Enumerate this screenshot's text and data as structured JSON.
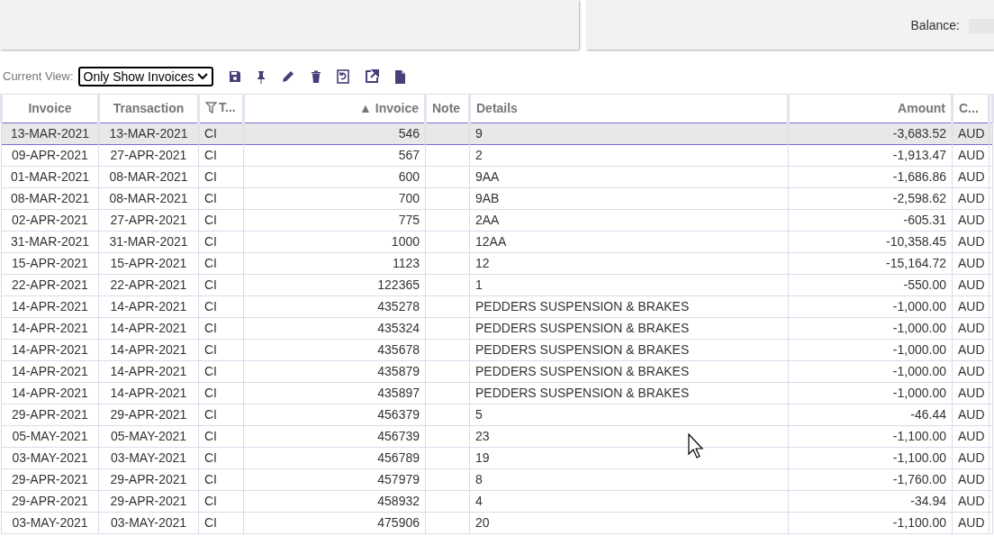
{
  "balance": {
    "label": "Balance:"
  },
  "toolbar": {
    "view_label": "Current View:",
    "view_value": "Only Show Invoices"
  },
  "table": {
    "columns": [
      {
        "label": "Invoice",
        "filter": false
      },
      {
        "label": "Transaction",
        "filter": false
      },
      {
        "label": "T...",
        "filter": true
      },
      {
        "label": "▲ Invoice",
        "filter": false
      },
      {
        "label": "Note",
        "filter": false
      },
      {
        "label": "Details",
        "filter": false
      },
      {
        "label": "Amount",
        "filter": false
      },
      {
        "label": "C...",
        "filter": false
      }
    ],
    "rows": [
      {
        "selected": true,
        "cells": [
          "13-MAR-2021",
          "13-MAR-2021",
          "CI",
          "546",
          "",
          "9",
          "-3,683.52",
          "AUD"
        ]
      },
      {
        "selected": false,
        "cells": [
          "09-APR-2021",
          "27-APR-2021",
          "CI",
          "567",
          "",
          "2",
          "-1,913.47",
          "AUD"
        ]
      },
      {
        "selected": false,
        "cells": [
          "01-MAR-2021",
          "08-MAR-2021",
          "CI",
          "600",
          "",
          "9AA",
          "-1,686.86",
          "AUD"
        ]
      },
      {
        "selected": false,
        "cells": [
          "08-MAR-2021",
          "08-MAR-2021",
          "CI",
          "700",
          "",
          "9AB",
          "-2,598.62",
          "AUD"
        ]
      },
      {
        "selected": false,
        "cells": [
          "02-APR-2021",
          "27-APR-2021",
          "CI",
          "775",
          "",
          "2AA",
          "-605.31",
          "AUD"
        ]
      },
      {
        "selected": false,
        "cells": [
          "31-MAR-2021",
          "31-MAR-2021",
          "CI",
          "1000",
          "",
          "12AA",
          "-10,358.45",
          "AUD"
        ]
      },
      {
        "selected": false,
        "cells": [
          "15-APR-2021",
          "15-APR-2021",
          "CI",
          "1123",
          "",
          "12",
          "-15,164.72",
          "AUD"
        ]
      },
      {
        "selected": false,
        "cells": [
          "22-APR-2021",
          "22-APR-2021",
          "CI",
          "122365",
          "",
          "1",
          "-550.00",
          "AUD"
        ]
      },
      {
        "selected": false,
        "cells": [
          "14-APR-2021",
          "14-APR-2021",
          "CI",
          "435278",
          "",
          "PEDDERS SUSPENSION & BRAKES",
          "-1,000.00",
          "AUD"
        ]
      },
      {
        "selected": false,
        "cells": [
          "14-APR-2021",
          "14-APR-2021",
          "CI",
          "435324",
          "",
          "PEDDERS SUSPENSION & BRAKES",
          "-1,000.00",
          "AUD"
        ]
      },
      {
        "selected": false,
        "cells": [
          "14-APR-2021",
          "14-APR-2021",
          "CI",
          "435678",
          "",
          "PEDDERS SUSPENSION & BRAKES",
          "-1,000.00",
          "AUD"
        ]
      },
      {
        "selected": false,
        "cells": [
          "14-APR-2021",
          "14-APR-2021",
          "CI",
          "435879",
          "",
          "PEDDERS SUSPENSION & BRAKES",
          "-1,000.00",
          "AUD"
        ]
      },
      {
        "selected": false,
        "cells": [
          "14-APR-2021",
          "14-APR-2021",
          "CI",
          "435897",
          "",
          "PEDDERS SUSPENSION & BRAKES",
          "-1,000.00",
          "AUD"
        ]
      },
      {
        "selected": false,
        "cells": [
          "29-APR-2021",
          "29-APR-2021",
          "CI",
          "456379",
          "",
          "5",
          "-46.44",
          "AUD"
        ]
      },
      {
        "selected": false,
        "cells": [
          "05-MAY-2021",
          "05-MAY-2021",
          "CI",
          "456739",
          "",
          "23",
          "-1,100.00",
          "AUD"
        ]
      },
      {
        "selected": false,
        "cells": [
          "03-MAY-2021",
          "03-MAY-2021",
          "CI",
          "456789",
          "",
          "19",
          "-1,100.00",
          "AUD"
        ]
      },
      {
        "selected": false,
        "cells": [
          "29-APR-2021",
          "29-APR-2021",
          "CI",
          "457979",
          "",
          "8",
          "-1,760.00",
          "AUD"
        ]
      },
      {
        "selected": false,
        "cells": [
          "29-APR-2021",
          "29-APR-2021",
          "CI",
          "458932",
          "",
          "4",
          "-34.94",
          "AUD"
        ]
      },
      {
        "selected": false,
        "cells": [
          "03-MAY-2021",
          "03-MAY-2021",
          "CI",
          "475906",
          "",
          "20",
          "-1,100.00",
          "AUD"
        ]
      }
    ]
  }
}
